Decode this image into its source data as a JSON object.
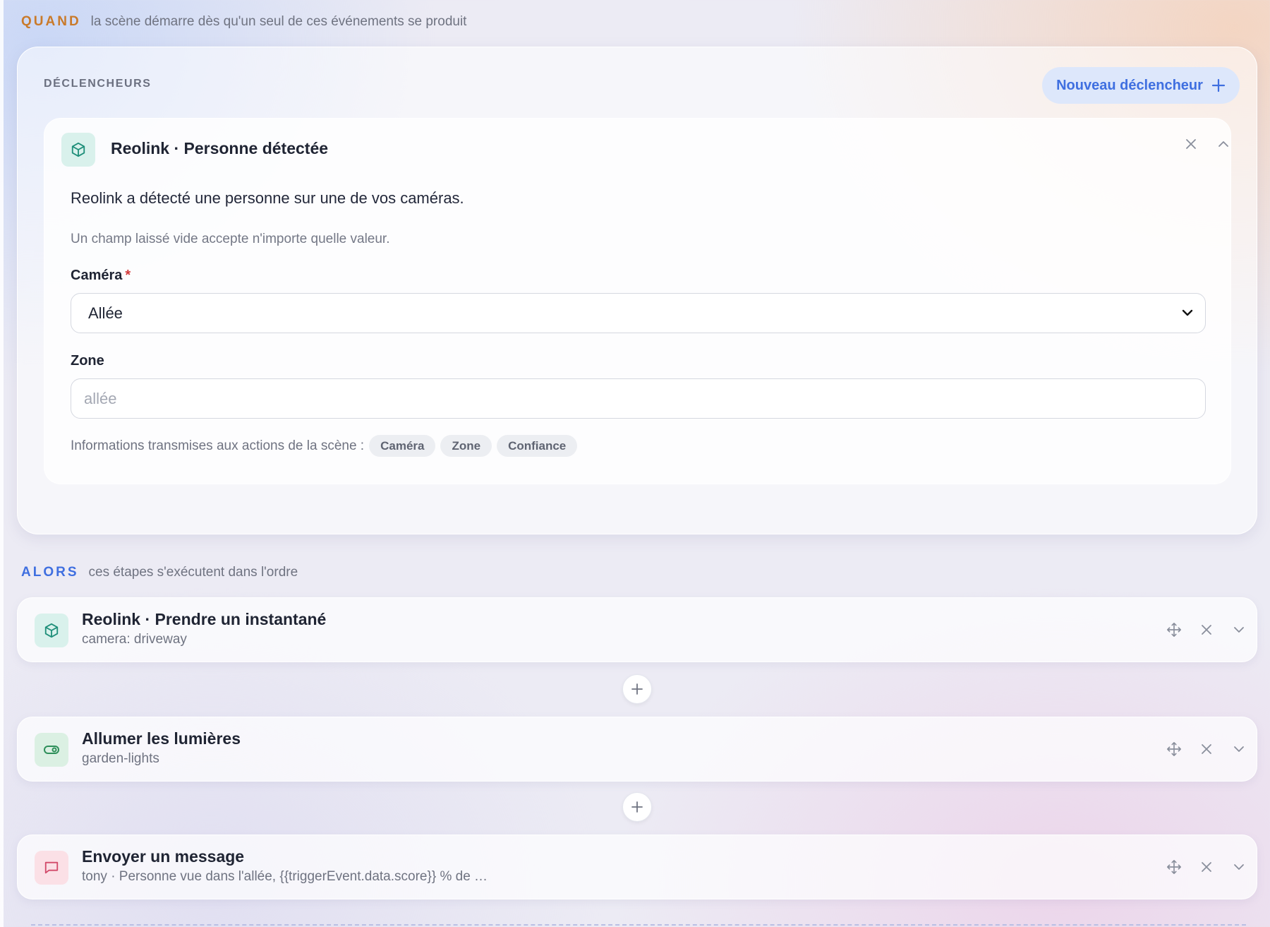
{
  "when": {
    "keyword": "QUAND",
    "description": "la scène démarre dès qu'un seul de ces événements se produit"
  },
  "triggers_panel": {
    "title": "DÉCLENCHEURS",
    "new_trigger_label": "Nouveau déclencheur",
    "new_trigger_icon": "plus-icon"
  },
  "trigger": {
    "icon": "cube-icon",
    "title": "Reolink · Personne détectée",
    "description": "Reolink a détecté une personne sur une de vos caméras.",
    "hint": "Un champ laissé vide accepte n'importe quelle valeur.",
    "camera_field": {
      "label": "Caméra",
      "required_mark": "*",
      "selected_value": "Allée"
    },
    "zone_field": {
      "label": "Zone",
      "value": "",
      "placeholder": "allée"
    },
    "passes_label": "Informations transmises aux actions de la scène :",
    "passes_chips": [
      "Caméra",
      "Zone",
      "Confiance"
    ]
  },
  "then": {
    "keyword": "ALORS",
    "description": "ces étapes s'exécutent dans l'ordre"
  },
  "steps": [
    {
      "icon": "cube-icon",
      "title": "Reolink · Prendre un instantané",
      "subtitle": "camera: driveway",
      "color": "#1f8f7a"
    },
    {
      "icon": "toggle-icon",
      "title": "Allumer les lumières",
      "subtitle": "garden-lights",
      "color": "#2e8f5a"
    },
    {
      "icon": "message-icon",
      "title": "Envoyer un message",
      "subtitle": "tony · Personne vue dans l'allée, {{triggerEvent.data.score}} % de …",
      "color": "#d24a6a"
    }
  ],
  "colors": {
    "when_accent": "#c97a2a",
    "then_accent": "#3f6fe0",
    "button_bg": "#dde7fb"
  }
}
